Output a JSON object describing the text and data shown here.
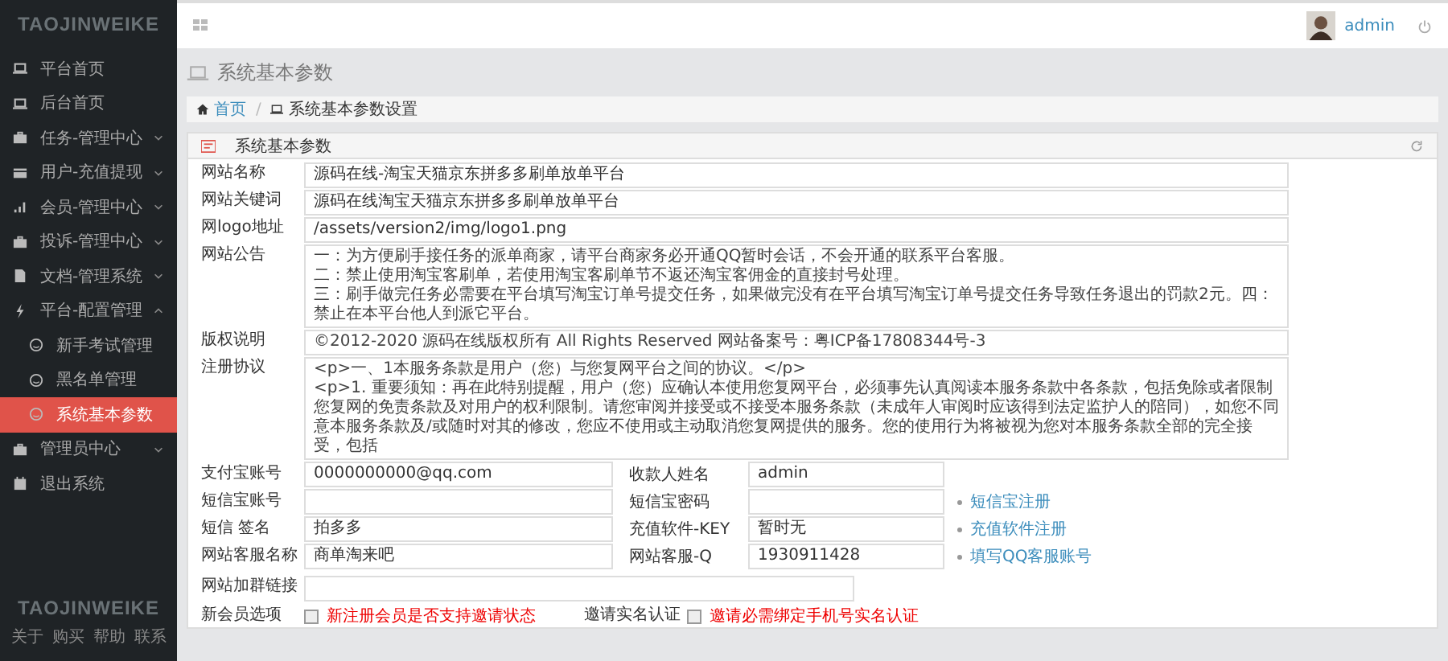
{
  "sidebar": {
    "logo": "TAOJINWEIKE",
    "items": [
      {
        "label": "平台首页",
        "kind": "laptop",
        "expandable": false,
        "selected": false
      },
      {
        "label": "后台首页",
        "kind": "laptop",
        "expandable": false,
        "selected": false
      },
      {
        "label": "任务-管理中心",
        "kind": "briefcase",
        "expandable": true,
        "expanded": false,
        "selected": false
      },
      {
        "label": "用户-充值提现",
        "kind": "card",
        "expandable": true,
        "expanded": false,
        "selected": false
      },
      {
        "label": "会员-管理中心",
        "kind": "signal",
        "expandable": true,
        "expanded": false,
        "selected": false
      },
      {
        "label": "投诉-管理中心",
        "kind": "briefcase",
        "expandable": true,
        "expanded": false,
        "selected": false
      },
      {
        "label": "文档-管理系统",
        "kind": "file",
        "expandable": true,
        "expanded": false,
        "selected": false
      },
      {
        "label": "平台-配置管理",
        "kind": "bolt",
        "expandable": true,
        "expanded": true,
        "selected": false,
        "children": [
          {
            "label": "新手考试管理",
            "kind": "smile",
            "selected": false
          },
          {
            "label": "黑名单管理",
            "kind": "smile",
            "selected": false
          },
          {
            "label": "系统基本参数",
            "kind": "smile",
            "selected": true
          }
        ]
      },
      {
        "label": "管理员中心",
        "kind": "briefcase",
        "expandable": true,
        "expanded": false,
        "selected": false
      },
      {
        "label": "退出系统",
        "kind": "calendar",
        "expandable": false,
        "selected": false
      }
    ],
    "footer_logo": "TAOJINWEIKE",
    "footer_links": [
      "关于",
      "购买",
      "帮助",
      "联系"
    ]
  },
  "topbar": {
    "user": "admin"
  },
  "page_title": "系统基本参数",
  "breadcrumb": [
    {
      "label": "首页",
      "kind": "home",
      "link": true
    },
    {
      "separator": "/",
      "label": "系统基本参数设置",
      "kind": "laptop",
      "link": false
    }
  ],
  "panel": {
    "title": "系统基本参数",
    "fields": [
      {
        "label": "网站名称",
        "kind": "input",
        "value": "源码在线-淘宝天猫京东拼多多刷单放单平台"
      },
      {
        "label": "网站关键词",
        "kind": "input",
        "value": "源码在线淘宝天猫京东拼多多刷单放单平台"
      },
      {
        "label": "网logo地址",
        "kind": "input",
        "value": "/assets/version2/img/logo1.png"
      },
      {
        "label": "网站公告",
        "kind": "textarea",
        "lines": [
          "一：为方便刷手接任务的派单商家，请平台商家务必开通QQ暂时会话，不会开通的联系平台客服。",
          "二：禁止使用淘宝客刷单，若使用淘宝客刷单节不返还淘宝客佣金的直接封号处理。",
          "三：刷手做完任务必需要在平台填写淘宝订单号提交任务，如果做完没有在平台填写淘宝订单号提交任务导致任务退出的罚款2元。四：禁止在本平台他人到派它平台。"
        ]
      },
      {
        "label": "版权说明",
        "kind": "textarea",
        "lines": [
          "©2012-2020 源码在线版权所有 All Rights Reserved 网站备案号：粤ICP备17808344号-3"
        ]
      },
      {
        "label": "注册协议",
        "kind": "textarea",
        "lines": [
          "<p>一、1本服务条款是用户（您）与您复网平台之间的协议。</p>",
          "<p>1. 重要须知：再在此特别提醒，用户（您）应确认本使用您复网平台，必须事先认真阅读本服务条款中各条款，包括免除或者限制您复网的免责条款及对用户的权利限制。请您审阅并接受或不接受本服务条款（未成年人审阅时应该得到法定监护人的陪同），如您不同意本服务条款及/或随时对其的修改，您应不使用或主动取消您复网提供的服务。您的使用行为将被视为您对本服务条款全部的完全接受，包括"
        ]
      }
    ],
    "pair_rows": [
      {
        "left": {
          "label": "支付宝账号",
          "value": "0000000000@qq.com"
        },
        "right": {
          "label": "收款人姓名",
          "value": "admin"
        }
      },
      {
        "left": {
          "label": "短信宝账号"
        },
        "right": {
          "label": "短信宝密码"
        },
        "link": "短信宝注册"
      },
      {
        "left": {
          "label": "短信 签名",
          "value": "拍多多"
        },
        "right": {
          "label": "充值软件-KEY",
          "value": "暂时无"
        },
        "link": "充值软件注册"
      },
      {
        "left": {
          "label": "网站客服名称",
          "value": "商单淘来吧"
        },
        "right": {
          "label": "网站客服-Q",
          "value": "1930911428"
        },
        "link": "填写QQ客服账号"
      }
    ],
    "group_link": {
      "label": "网站加群链接"
    },
    "options": [
      {
        "label": "新会员选项",
        "checked": false,
        "note": "新注册会员是否支持邀请状态"
      },
      {
        "label": "邀请实名认证",
        "checked": false,
        "note": "邀请必需绑定手机号实名认证"
      }
    ]
  }
}
